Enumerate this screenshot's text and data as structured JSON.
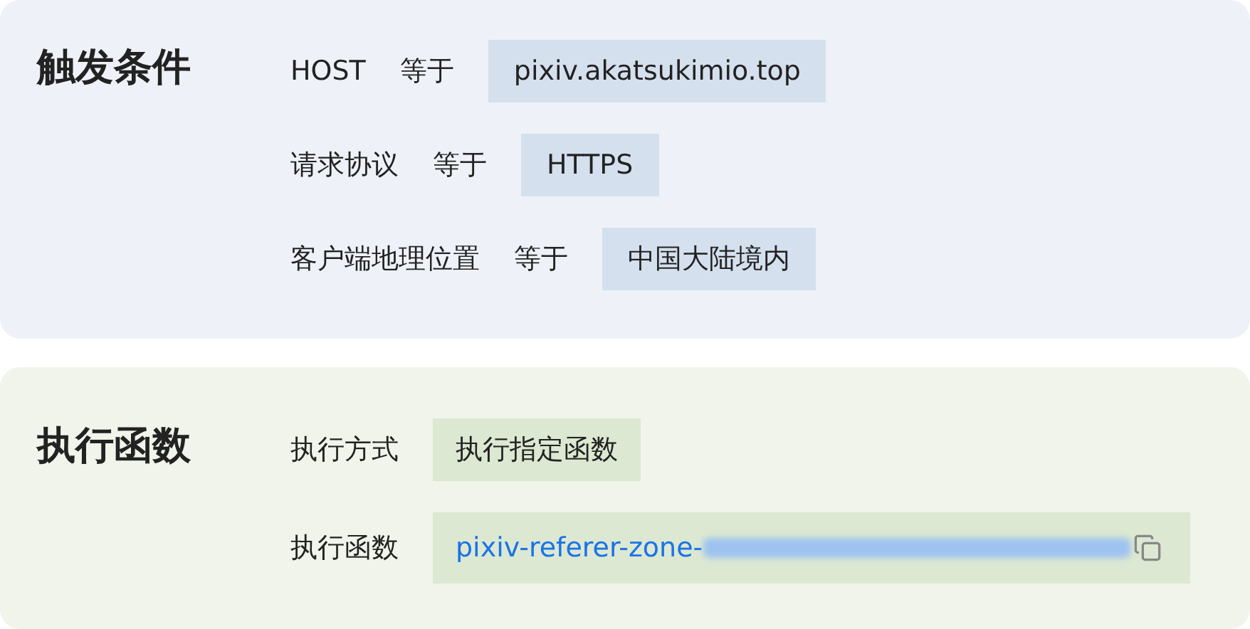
{
  "trigger": {
    "title": "触发条件",
    "conditions": [
      {
        "field": "HOST",
        "operator": "等于",
        "value": "pixiv.akatsukimio.top"
      },
      {
        "field": "请求协议",
        "operator": "等于",
        "value": "HTTPS"
      },
      {
        "field": "客户端地理位置",
        "operator": "等于",
        "value": "中国大陆境内"
      }
    ]
  },
  "action": {
    "title": "执行函数",
    "rows": [
      {
        "label": "执行方式",
        "kind": "text",
        "value": "执行指定函数"
      },
      {
        "label": "执行函数",
        "kind": "link",
        "value": "pixiv-referer-zone-"
      }
    ]
  }
}
